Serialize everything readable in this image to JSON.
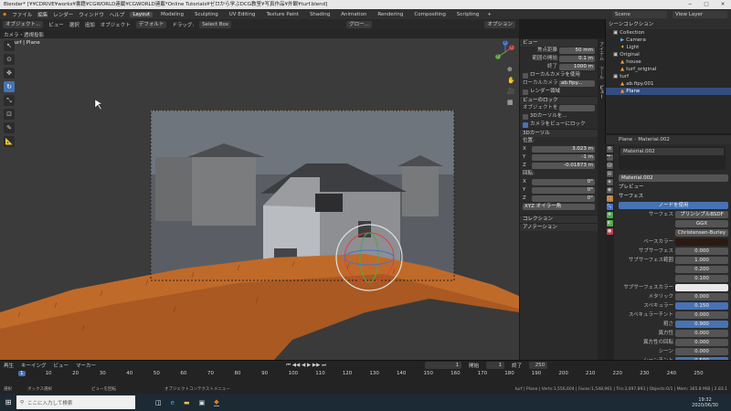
{
  "window": {
    "title": "Blender* [¥¥CDRIVE¥works¥書籍¥CGWORLD連載¥CGWORLD連載*Online Tutorials¥ゼロから学ぶDCG教室¥写真作品¥外観¥turf.blend]",
    "minimize": "─",
    "maximize": "□",
    "close": "✕"
  },
  "menu": {
    "logo": "◆",
    "items": [
      "ファイル",
      "編集",
      "レンダー",
      "ウィンドウ",
      "ヘルプ"
    ],
    "workspaces": [
      "Layout",
      "Modeling",
      "Sculpting",
      "UV Editing",
      "Texture Paint",
      "Shading",
      "Animation",
      "Rendering",
      "Compositing",
      "Scripting"
    ],
    "active_workspace": "Layout",
    "scene": "Scene",
    "view_layer": "View Layer",
    "add_tab": "+"
  },
  "header": {
    "mode": "オブジェクト...",
    "view": "ビュー",
    "select": "選択",
    "add": "追加",
    "object": "オブジェクト",
    "orientation": "デフォルト",
    "drag": "ドラッグ:",
    "select_box": "Select Box",
    "global": "グロー...",
    "options": "オプション"
  },
  "viewport": {
    "camera_label": "カメラ・透視投影",
    "object_label": "(1) turf | Plane"
  },
  "axes": {
    "x": "X",
    "y": "Y",
    "z": "Z"
  },
  "npanel": {
    "tabs": [
      "アイテム",
      "ツール",
      "ビュー"
    ],
    "view_section": "ビュー",
    "focal_label": "焦点距離",
    "focal_value": "50 mm",
    "clip_start_label": "範囲の開始",
    "clip_start": "0.1 m",
    "clip_end_label": "終了",
    "clip_end": "1000 m",
    "local_camera_label": "ローカルカメラを使用",
    "local_camera": "ローカルカメラ",
    "local_camera_value": "ab.fipy...",
    "render_region": "レンダー領域",
    "view_lock_section": "ビューのロック",
    "lock_object_label": "オブジェクトを...",
    "lock_3d_cursor": "3Dカーソルを...",
    "camera_to_view": "カメラをビューにロック",
    "cursor_section": "3Dカーソル",
    "location_label": "位置:",
    "loc": [
      {
        "axis": "X",
        "value": "3.023 m"
      },
      {
        "axis": "Y",
        "value": "-1 m"
      },
      {
        "axis": "Z",
        "value": "-0.01873 m"
      }
    ],
    "rotation_label": "回転:",
    "rot": [
      {
        "axis": "X",
        "value": "0°"
      },
      {
        "axis": "Y",
        "value": "0°"
      },
      {
        "axis": "Z",
        "value": "0°"
      }
    ],
    "rotation_mode": "XYZ オイラー角",
    "collection_section": "コレクション",
    "annotation_section": "アノテーション"
  },
  "outliner": {
    "title": "シーンコレクション",
    "rows": [
      {
        "indent": 1,
        "label": "Collection",
        "sel": false
      },
      {
        "indent": 2,
        "label": "Camera",
        "sel": false
      },
      {
        "indent": 2,
        "label": "Light",
        "sel": false
      },
      {
        "indent": 1,
        "label": "Original",
        "sel": false
      },
      {
        "indent": 2,
        "label": "house",
        "sel": false
      },
      {
        "indent": 2,
        "label": "turf_original",
        "sel": false
      },
      {
        "indent": 1,
        "label": "turf",
        "sel": false
      },
      {
        "indent": 2,
        "label": "ab.fipy.001",
        "sel": false
      },
      {
        "indent": 2,
        "label": "Plane",
        "sel": true
      }
    ]
  },
  "properties": {
    "object": "Plane",
    "material_crumb": "Material.002",
    "slot": "Material.002",
    "material_name": "Material.002",
    "preview": "プレビュー",
    "surface": "サーフェス",
    "use_nodes": "ノードを使用",
    "surface_label": "サーフェス",
    "shader": "プリンシプルBSDF",
    "distribution": "GGX",
    "subsurface_method": "Christensen-Burley",
    "fields": [
      {
        "label": "ベースカラー",
        "value": "",
        "blue": false,
        "swatch": "#2a1a12"
      },
      {
        "label": "サブサーフェス",
        "value": "0.000",
        "blue": false
      },
      {
        "label": "サブサーフェス範囲",
        "value": "1.000",
        "blue": false
      },
      {
        "label": "",
        "value": "0.200",
        "blue": false
      },
      {
        "label": "",
        "value": "0.100",
        "blue": false
      },
      {
        "label": "サブサーフェスカラー",
        "value": "",
        "blue": false,
        "swatch": "#e8e8e8"
      },
      {
        "label": "メタリック",
        "value": "0.000",
        "blue": false
      },
      {
        "label": "スペキュラー",
        "value": "0.150",
        "blue": true
      },
      {
        "label": "スペキュラーチント",
        "value": "0.000",
        "blue": false
      },
      {
        "label": "粗さ",
        "value": "0.900",
        "blue": true
      },
      {
        "label": "異方性",
        "value": "0.000",
        "blue": false
      },
      {
        "label": "異方性の回転",
        "value": "0.000",
        "blue": false
      },
      {
        "label": "シーン",
        "value": "0.000",
        "blue": false
      },
      {
        "label": "シーンチント",
        "value": "0.500",
        "blue": true
      }
    ]
  },
  "timeline": {
    "menu": [
      "再生",
      "キーイング",
      "ビュー",
      "マーカー"
    ],
    "current_frame": "1",
    "start_label": "開始",
    "start": "1",
    "end_label": "終了",
    "end": "250",
    "ticks": [
      "1",
      "10",
      "20",
      "30",
      "40",
      "50",
      "60",
      "70",
      "80",
      "90",
      "100",
      "110",
      "120",
      "130",
      "140",
      "150",
      "160",
      "170",
      "180",
      "190",
      "200",
      "210",
      "220",
      "230",
      "240",
      "250"
    ],
    "transport": "⏮ ◀◀ ◀ ▶ ▶▶ ⏭"
  },
  "status": {
    "left": "選択",
    "box": "ボックス選択",
    "rotate": "ビューを回転",
    "context": "オブジェクトコンテクストメニュー",
    "stats": "turf | Plane | Verts:1,556,604 | Faces:1,548,961 | Tris:3,097,893 | Objects:0/1 | Mem: 365.8 MiB | 2.83.1"
  },
  "taskbar": {
    "start": "⊞",
    "search_placeholder": "ここに入力して検索",
    "time": "19:32",
    "date": "2020/06/30"
  },
  "colors": {
    "accent": "#4772b3",
    "turf": "#c06a2a",
    "selection": "#ff8c00"
  }
}
